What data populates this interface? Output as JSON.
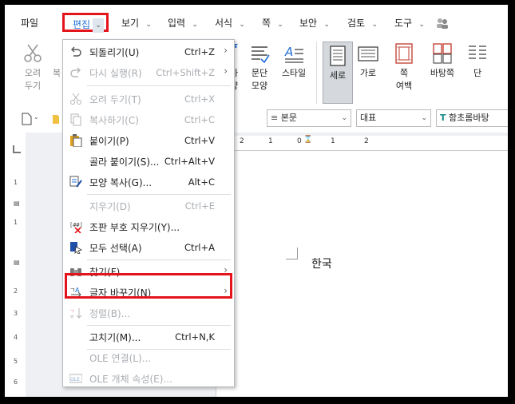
{
  "menubar": {
    "items": [
      {
        "label": "파일",
        "chevron": false
      },
      {
        "label": "편집",
        "chevron": true,
        "active": true
      },
      {
        "label": "보기",
        "chevron": true
      },
      {
        "label": "입력",
        "chevron": true
      },
      {
        "label": "서식",
        "chevron": true
      },
      {
        "label": "쪽",
        "chevron": true
      },
      {
        "label": "보안",
        "chevron": true
      },
      {
        "label": "검토",
        "chevron": true
      },
      {
        "label": "도구",
        "chevron": true
      }
    ]
  },
  "ribbon": {
    "cut": {
      "line1": "오려",
      "line2": "두기"
    },
    "copy_partial": "복",
    "char_partial": {
      "line1": "자",
      "line2": "양"
    },
    "paragraph": {
      "line1": "문단",
      "line2": "모양"
    },
    "style": {
      "line1": "스타일"
    },
    "portrait": {
      "line1": "세로"
    },
    "landscape": {
      "line1": "가로"
    },
    "margin": {
      "line1": "쪽",
      "line2": "여백"
    },
    "background": {
      "line1": "바탕쪽"
    },
    "columns": {
      "line1": "단"
    }
  },
  "toolbar": {
    "style_combo": "본문",
    "font_lang_combo": "대표",
    "font_combo": "함초롬바탕"
  },
  "document": {
    "text": "한국"
  },
  "hruler": {
    "labels": [
      "2",
      "1",
      "0",
      "1",
      "2"
    ]
  },
  "vruler": {
    "labels": [
      "1",
      "1",
      "2",
      "3",
      "4",
      "5",
      "6"
    ]
  },
  "edit_menu": {
    "items": [
      {
        "label": "되돌리기(U)",
        "shortcut": "Ctrl+Z",
        "arrow": true,
        "disabled": false
      },
      {
        "label": "다시 실행(R)",
        "shortcut": "Ctrl+Shift+Z",
        "arrow": true,
        "disabled": true
      },
      {
        "label": "오려 두기(T)",
        "shortcut": "Ctrl+X",
        "disabled": true
      },
      {
        "label": "복사하기(C)",
        "shortcut": "Ctrl+C",
        "disabled": true
      },
      {
        "label": "붙이기(P)",
        "shortcut": "Ctrl+V",
        "disabled": false
      },
      {
        "label": "골라 붙이기(S)...",
        "shortcut": "Ctrl+Alt+V",
        "disabled": false
      },
      {
        "label": "모양 복사(G)...",
        "shortcut": "Alt+C",
        "disabled": false
      },
      {
        "label": "지우기(D)",
        "shortcut": "Ctrl+E",
        "disabled": true
      },
      {
        "label": "조판 부호 지우기(Y)...",
        "shortcut": "",
        "disabled": false
      },
      {
        "label": "모두 선택(A)",
        "shortcut": "Ctrl+A",
        "disabled": false
      },
      {
        "label": "찾기(F)",
        "shortcut": "",
        "arrow": true,
        "disabled": false
      },
      {
        "label": "글자 바꾸기(N)",
        "shortcut": "",
        "arrow": true,
        "disabled": false
      },
      {
        "label": "정렬(B)...",
        "shortcut": "",
        "disabled": true
      },
      {
        "label": "고치기(M)...",
        "shortcut": "Ctrl+N,K",
        "disabled": false
      },
      {
        "label": "OLE 연결(L)...",
        "shortcut": "",
        "disabled": true
      },
      {
        "label": "OLE 개체 속성(E)...",
        "shortcut": "",
        "disabled": true
      }
    ]
  },
  "colors": {
    "highlight": "#e4141b",
    "active_tab_text": "#1f6fd6"
  }
}
